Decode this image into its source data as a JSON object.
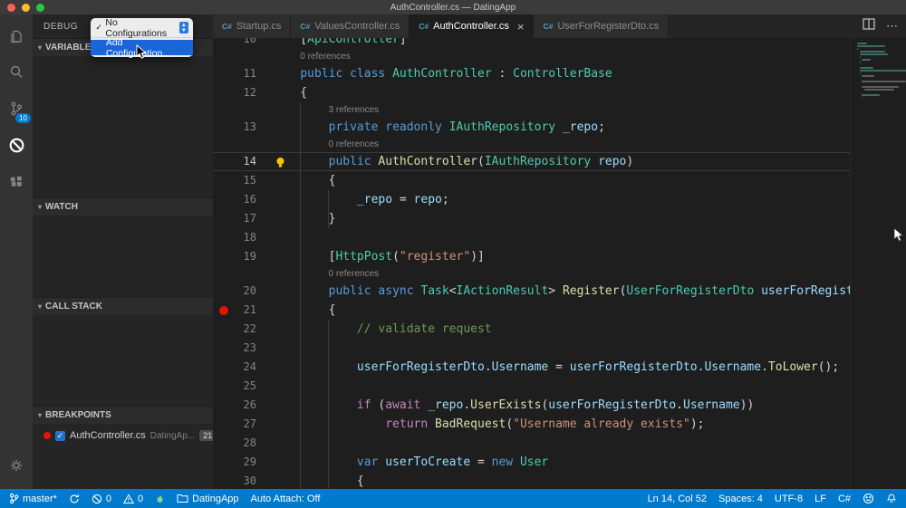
{
  "window": {
    "title": "AuthController.cs — DatingApp"
  },
  "icons": {
    "check": "✓",
    "close": "×",
    "more": "⋯",
    "chevron": "▾",
    "csharp": "C#"
  },
  "activity_bar": {
    "scm_badge": "10"
  },
  "sidebar": {
    "header": "DEBUG",
    "dropdown_menu": {
      "items": [
        {
          "label": "No Configurations",
          "checked": true,
          "highlighted": false
        },
        {
          "label": "Add Configuration...",
          "checked": false,
          "highlighted": true
        }
      ]
    },
    "sections": [
      {
        "label": "VARIABLES"
      },
      {
        "label": "WATCH"
      },
      {
        "label": "CALL STACK"
      },
      {
        "label": "BREAKPOINTS"
      }
    ],
    "breakpoints": [
      {
        "file": "AuthController.cs",
        "folder": "DatingAp...",
        "line": "21",
        "checked": true
      }
    ]
  },
  "tabs": [
    {
      "label": "Startup.cs",
      "active": false
    },
    {
      "label": "ValuesController.cs",
      "active": false
    },
    {
      "label": "AuthController.cs",
      "active": true
    },
    {
      "label": "UserForRegisterDto.cs",
      "active": false
    }
  ],
  "editor": {
    "lines": [
      {
        "num": "10",
        "cut": true,
        "tokens": [
          [
            "    [",
            "pun"
          ],
          [
            "ApiController",
            "type"
          ],
          [
            "]",
            "pun"
          ]
        ]
      },
      {
        "codelens": "0 references",
        "indent": 4
      },
      {
        "num": "11",
        "tokens": [
          [
            "    ",
            "pun"
          ],
          [
            "public",
            "kw"
          ],
          [
            " ",
            "pun"
          ],
          [
            "class",
            "kw"
          ],
          [
            " ",
            "pun"
          ],
          [
            "AuthController",
            "type"
          ],
          [
            " : ",
            "pun"
          ],
          [
            "ControllerBase",
            "type"
          ]
        ]
      },
      {
        "num": "12",
        "tokens": [
          [
            "    {",
            "pun"
          ]
        ]
      },
      {
        "codelens": "3 references",
        "indent": 8
      },
      {
        "num": "13",
        "tokens": [
          [
            "        ",
            "pun"
          ],
          [
            "private",
            "kw"
          ],
          [
            " ",
            "pun"
          ],
          [
            "readonly",
            "kw"
          ],
          [
            " ",
            "pun"
          ],
          [
            "IAuthRepository",
            "type"
          ],
          [
            " ",
            "pun"
          ],
          [
            "_repo",
            "var"
          ],
          [
            ";",
            "pun"
          ]
        ]
      },
      {
        "codelens": "0 references",
        "indent": 8
      },
      {
        "num": "14",
        "current": true,
        "lightbulb": true,
        "tokens": [
          [
            "        ",
            "pun"
          ],
          [
            "public",
            "kw"
          ],
          [
            " ",
            "pun"
          ],
          [
            "AuthController",
            "fn"
          ],
          [
            "(",
            "pun"
          ],
          [
            "IAuthRepository",
            "type"
          ],
          [
            " ",
            "pun"
          ],
          [
            "repo",
            "var"
          ],
          [
            ")",
            "pun"
          ]
        ]
      },
      {
        "num": "15",
        "tokens": [
          [
            "        {",
            "pun"
          ]
        ]
      },
      {
        "num": "16",
        "tokens": [
          [
            "            ",
            "pun"
          ],
          [
            "_repo",
            "var"
          ],
          [
            " = ",
            "pun"
          ],
          [
            "repo",
            "var"
          ],
          [
            ";",
            "pun"
          ]
        ]
      },
      {
        "num": "17",
        "tokens": [
          [
            "        }",
            "pun"
          ]
        ]
      },
      {
        "num": "18",
        "tokens": []
      },
      {
        "num": "19",
        "tokens": [
          [
            "        [",
            "pun"
          ],
          [
            "HttpPost",
            "type"
          ],
          [
            "(",
            "pun"
          ],
          [
            "\"register\"",
            "str"
          ],
          [
            ")]",
            "pun"
          ]
        ]
      },
      {
        "codelens": "0 references",
        "indent": 8
      },
      {
        "num": "20",
        "tokens": [
          [
            "        ",
            "pun"
          ],
          [
            "public",
            "kw"
          ],
          [
            " ",
            "pun"
          ],
          [
            "async",
            "kw"
          ],
          [
            " ",
            "pun"
          ],
          [
            "Task",
            "type"
          ],
          [
            "<",
            "pun"
          ],
          [
            "IActionResult",
            "type"
          ],
          [
            "> ",
            "pun"
          ],
          [
            "Register",
            "fn"
          ],
          [
            "(",
            "pun"
          ],
          [
            "UserForRegisterDto",
            "type"
          ],
          [
            " ",
            "pun"
          ],
          [
            "userForRegisterDto",
            "var"
          ],
          [
            ")",
            "pun"
          ]
        ]
      },
      {
        "num": "21",
        "breakpoint": true,
        "tokens": [
          [
            "        {",
            "pun"
          ]
        ]
      },
      {
        "num": "22",
        "tokens": [
          [
            "            ",
            "pun"
          ],
          [
            "// validate request",
            "com"
          ]
        ]
      },
      {
        "num": "23",
        "tokens": []
      },
      {
        "num": "24",
        "tokens": [
          [
            "            ",
            "pun"
          ],
          [
            "userForRegisterDto",
            "var"
          ],
          [
            ".",
            "pun"
          ],
          [
            "Username",
            "var"
          ],
          [
            " = ",
            "pun"
          ],
          [
            "userForRegisterDto",
            "var"
          ],
          [
            ".",
            "pun"
          ],
          [
            "Username",
            "var"
          ],
          [
            ".",
            "pun"
          ],
          [
            "ToLower",
            "fn"
          ],
          [
            "();",
            "pun"
          ]
        ]
      },
      {
        "num": "25",
        "tokens": []
      },
      {
        "num": "26",
        "tokens": [
          [
            "            ",
            "pun"
          ],
          [
            "if",
            "ctrl"
          ],
          [
            " (",
            "pun"
          ],
          [
            "await",
            "ctrl"
          ],
          [
            " ",
            "pun"
          ],
          [
            "_repo",
            "var"
          ],
          [
            ".",
            "pun"
          ],
          [
            "UserExists",
            "fn"
          ],
          [
            "(",
            "pun"
          ],
          [
            "userForRegisterDto",
            "var"
          ],
          [
            ".",
            "pun"
          ],
          [
            "Username",
            "var"
          ],
          [
            "))",
            "pun"
          ]
        ]
      },
      {
        "num": "27",
        "tokens": [
          [
            "                ",
            "pun"
          ],
          [
            "return",
            "ctrl"
          ],
          [
            " ",
            "pun"
          ],
          [
            "BadRequest",
            "fn"
          ],
          [
            "(",
            "pun"
          ],
          [
            "\"Username already exists\"",
            "str"
          ],
          [
            ");",
            "pun"
          ]
        ]
      },
      {
        "num": "28",
        "tokens": []
      },
      {
        "num": "29",
        "tokens": [
          [
            "            ",
            "pun"
          ],
          [
            "var",
            "kw"
          ],
          [
            " ",
            "pun"
          ],
          [
            "userToCreate",
            "var"
          ],
          [
            " = ",
            "pun"
          ],
          [
            "new",
            "kw"
          ],
          [
            " ",
            "pun"
          ],
          [
            "User",
            "type"
          ]
        ]
      },
      {
        "num": "30",
        "tokens": [
          [
            "            {",
            "pun"
          ]
        ]
      }
    ]
  },
  "status_bar": {
    "left": [
      {
        "icon": "git-branch",
        "label": "master*"
      },
      {
        "icon": "sync",
        "label": ""
      },
      {
        "icon": "error",
        "label": "0"
      },
      {
        "icon": "warning",
        "label": "0"
      },
      {
        "icon": "flame",
        "label": ""
      },
      {
        "icon": "folder",
        "label": "DatingApp"
      },
      {
        "icon": "",
        "label": "Auto Attach: Off"
      }
    ],
    "right": [
      {
        "icon": "",
        "label": "Ln 14, Col 52"
      },
      {
        "icon": "",
        "label": "Spaces: 4"
      },
      {
        "icon": "",
        "label": "UTF-8"
      },
      {
        "icon": "",
        "label": "LF"
      },
      {
        "icon": "",
        "label": "C#"
      },
      {
        "icon": "smiley",
        "label": ""
      },
      {
        "icon": "bell",
        "label": ""
      }
    ]
  }
}
